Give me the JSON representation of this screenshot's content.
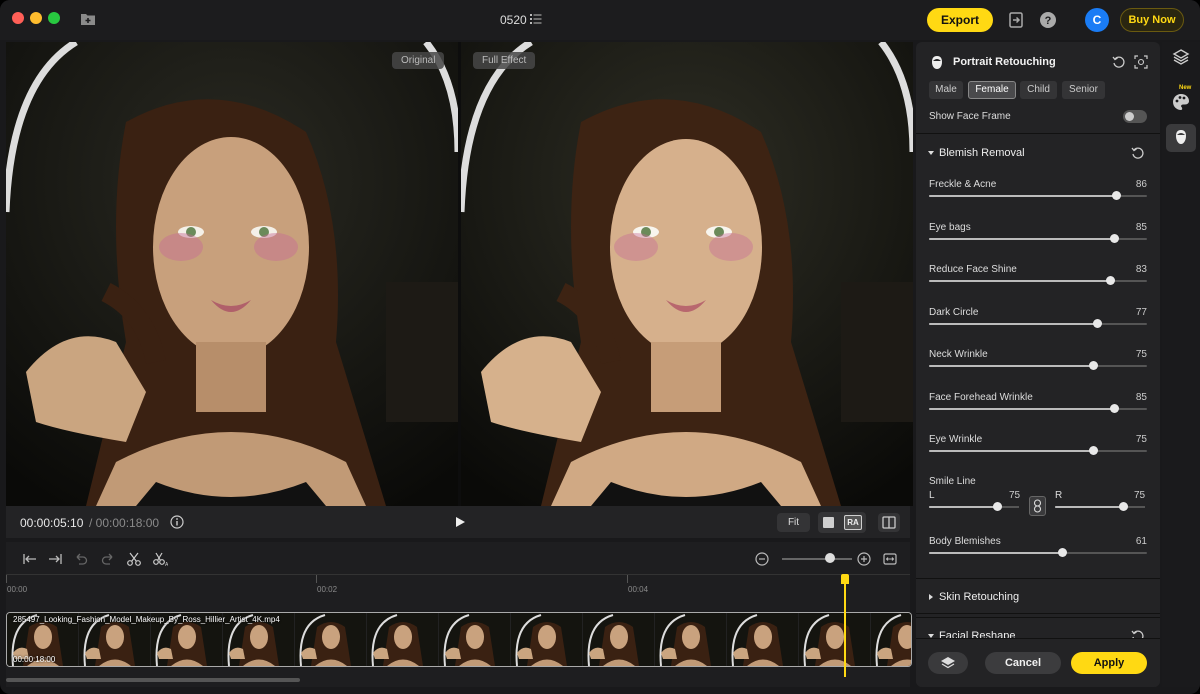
{
  "titlebar": {
    "project_title": "0520",
    "export_label": "Export",
    "avatar_initial": "C",
    "buy_label": "Buy Now"
  },
  "preview": {
    "left_label": "Original",
    "right_label": "Full Effect"
  },
  "controls": {
    "current_time": "00:00:05:10",
    "total_time": "/ 00:00:18:00",
    "fit_label": "Fit",
    "view_mode_ra": "RA"
  },
  "timeline": {
    "ruler_labels": [
      "00:00",
      "00:02",
      "00:04"
    ],
    "clip_name": "285497_Looking_Fashion_Model_Makeup_By_Ross_Hillier_Artist_4K.mp4",
    "clip_duration": "00:00:18:00",
    "zoom_level": 0.72,
    "playhead_position": "00:05"
  },
  "panel": {
    "title": "Portrait Retouching",
    "presets": [
      "Male",
      "Female",
      "Child",
      "Senior"
    ],
    "active_preset": "Female",
    "show_face_frame_label": "Show Face Frame",
    "show_face_frame": false,
    "blemish_section": "Blemish Removal",
    "sliders": [
      {
        "label": "Freckle & Acne",
        "value": "86"
      },
      {
        "label": "Eye bags",
        "value": "85"
      },
      {
        "label": "Reduce Face Shine",
        "value": "83"
      },
      {
        "label": "Dark Circle",
        "value": "77"
      },
      {
        "label": "Neck Wrinkle",
        "value": "75"
      },
      {
        "label": "Face Forehead Wrinkle",
        "value": "85"
      },
      {
        "label": "Eye Wrinkle",
        "value": "75"
      }
    ],
    "smile_line": {
      "label": "Smile Line",
      "left_label": "L",
      "left_value": "75",
      "right_label": "R",
      "right_value": "75"
    },
    "body_blemishes": {
      "label": "Body Blemishes",
      "value": "61"
    },
    "skin_section": "Skin Retouching",
    "facial_section": "Facial Reshape",
    "cancel_label": "Cancel",
    "apply_label": "Apply"
  },
  "strip": {
    "new_badge": "New"
  },
  "colors": {
    "accent": "#ffd913",
    "avatar": "#1a7cf5",
    "background": "#19191b",
    "panel": "#232325"
  }
}
